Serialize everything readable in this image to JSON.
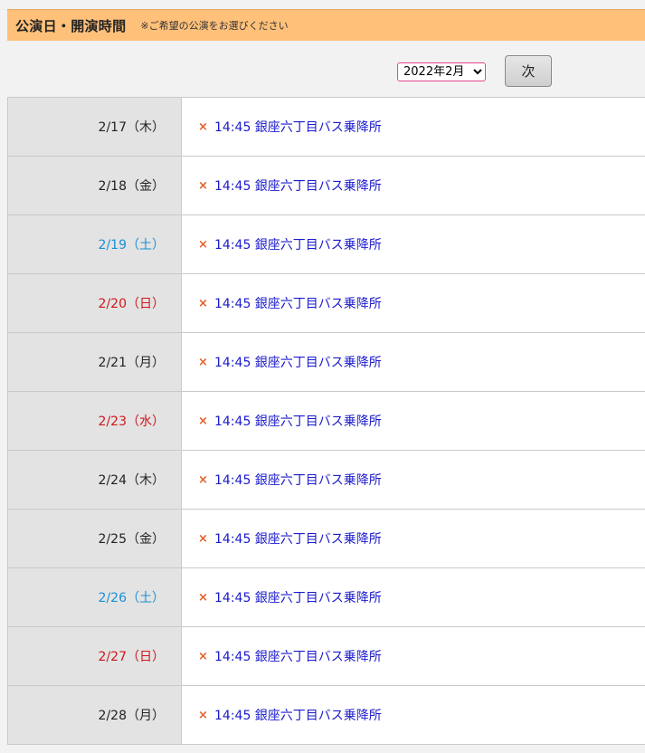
{
  "header": {
    "title": "公演日・開演時間",
    "note": "※ご希望の公演をお選びください"
  },
  "controls": {
    "month_selected": "2022年2月",
    "next_label": "次"
  },
  "schedule": [
    {
      "date": "2/17（木）",
      "day_type": "weekday",
      "mark": "×",
      "performance": "14:45 銀座六丁目バス乗降所"
    },
    {
      "date": "2/18（金）",
      "day_type": "weekday",
      "mark": "×",
      "performance": "14:45 銀座六丁目バス乗降所"
    },
    {
      "date": "2/19（土）",
      "day_type": "saturday",
      "mark": "×",
      "performance": "14:45 銀座六丁目バス乗降所"
    },
    {
      "date": "2/20（日）",
      "day_type": "holiday",
      "mark": "×",
      "performance": "14:45 銀座六丁目バス乗降所"
    },
    {
      "date": "2/21（月）",
      "day_type": "weekday",
      "mark": "×",
      "performance": "14:45 銀座六丁目バス乗降所"
    },
    {
      "date": "2/23（水）",
      "day_type": "holiday",
      "mark": "×",
      "performance": "14:45 銀座六丁目バス乗降所"
    },
    {
      "date": "2/24（木）",
      "day_type": "weekday",
      "mark": "×",
      "performance": "14:45 銀座六丁目バス乗降所"
    },
    {
      "date": "2/25（金）",
      "day_type": "weekday",
      "mark": "×",
      "performance": "14:45 銀座六丁目バス乗降所"
    },
    {
      "date": "2/26（土）",
      "day_type": "saturday",
      "mark": "×",
      "performance": "14:45 銀座六丁目バス乗降所"
    },
    {
      "date": "2/27（日）",
      "day_type": "holiday",
      "mark": "×",
      "performance": "14:45 銀座六丁目バス乗降所"
    },
    {
      "date": "2/28（月）",
      "day_type": "weekday",
      "mark": "×",
      "performance": "14:45 銀座六丁目バス乗降所"
    }
  ],
  "colors": {
    "header_bg": "#ffc07a",
    "saturday": "#1a8fd6",
    "holiday": "#d0161b",
    "mark": "#e0602a",
    "link": "#1a1acc"
  }
}
